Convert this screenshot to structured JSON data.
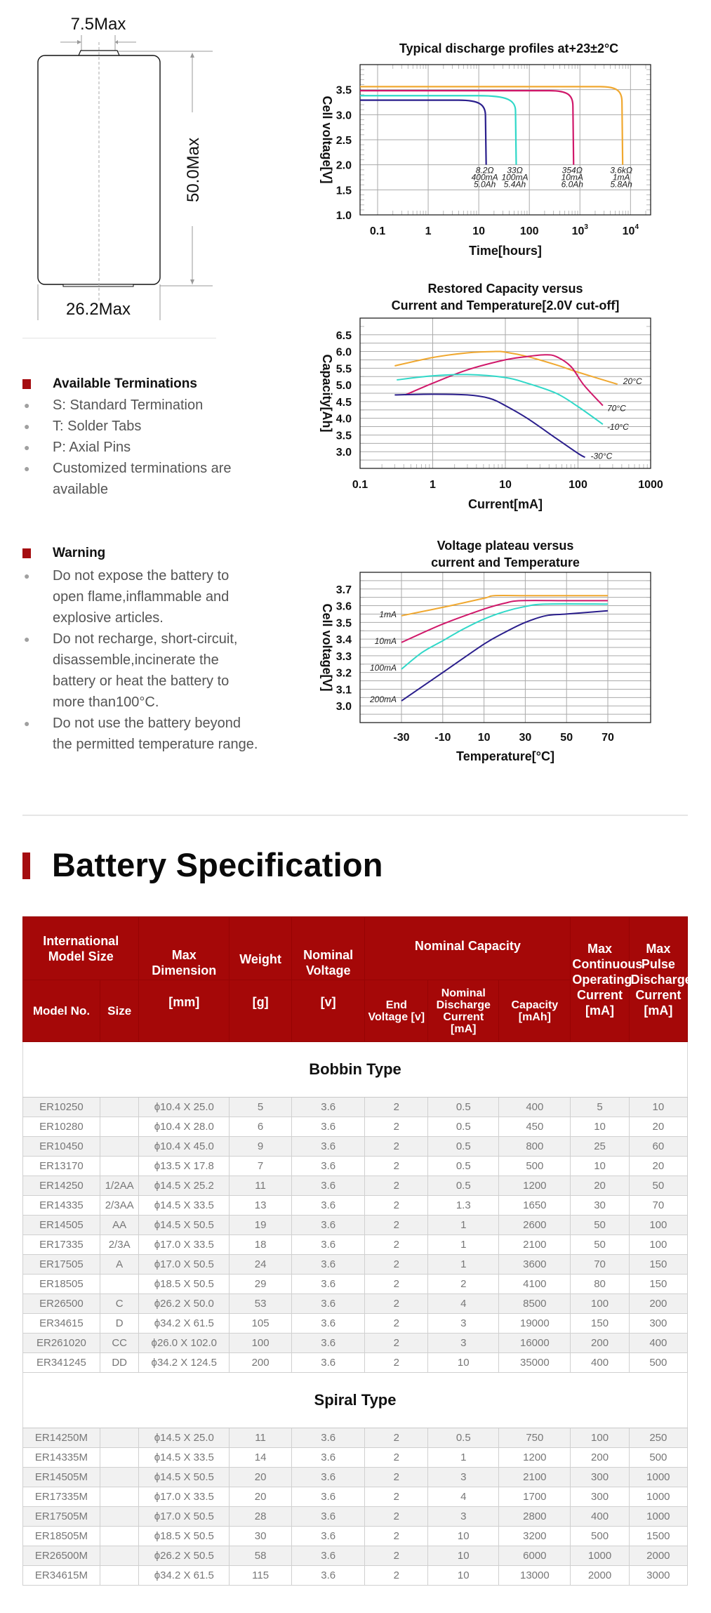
{
  "drawing": {
    "top_width_label": "7.5Max",
    "height_label": "50.0Max",
    "diameter_label": "26.2Max"
  },
  "terminations": {
    "title": "Available Terminations",
    "items": [
      "S: Standard Termination",
      "T: Solder Tabs",
      "P: Axial Pins",
      "Customized terminations are available"
    ]
  },
  "warning": {
    "title": "Warning",
    "items": [
      "Do not expose the battery to open flame,inflammable and explosive articles.",
      "Do not recharge, short-circuit, disassemble,incinerate the battery or heat the battery to more than100°C.",
      "Do not use the battery beyond the permitted temperature range."
    ]
  },
  "colors": {
    "accent_red": "#a50d10",
    "header_red": "#a50808",
    "series_orange": "#f0a830",
    "series_magenta": "#d0186a",
    "series_cyan": "#30d8c8",
    "series_navy": "#2a1e8c"
  },
  "chart_data": [
    {
      "type": "line",
      "title": "Typical discharge profiles at+23±2°C",
      "xlabel": "Time[hours]",
      "ylabel": "Cell voltage[V]",
      "x_scale": "log",
      "xlim": [
        0.045,
        25000
      ],
      "ylim": [
        1.0,
        4.0
      ],
      "xticks": [
        0.1,
        1,
        10,
        100,
        1000,
        10000
      ],
      "xtick_labels": [
        "0.1",
        "1",
        "10",
        "100",
        "10^3",
        "10^4"
      ],
      "yticks": [
        1.0,
        1.5,
        2.0,
        2.5,
        3.0,
        3.5
      ],
      "ytick_labels": [
        "1.0",
        "1.5",
        "2.0",
        "2.5",
        "3.0",
        "3.5"
      ],
      "grid": true,
      "series": [
        {
          "name": "3.6kΩ 1mA 5.8Ah",
          "color": "#f0a830",
          "plateau_v": 3.56,
          "knee_start_h": 2500,
          "end_h": 7000,
          "cutoff_v": 2.0,
          "annotation": [
            "3.6kΩ",
            "1mA",
            "5.8Ah"
          ]
        },
        {
          "name": "354Ω 10mA 6.0Ah",
          "color": "#d0186a",
          "plateau_v": 3.48,
          "knee_start_h": 250,
          "end_h": 750,
          "cutoff_v": 2.0,
          "annotation": [
            "354Ω",
            "10mA",
            "6.0Ah"
          ]
        },
        {
          "name": "33Ω 100mA 5.4Ah",
          "color": "#30d8c8",
          "plateau_v": 3.38,
          "knee_start_h": 10,
          "end_h": 55,
          "cutoff_v": 2.0,
          "annotation": [
            "33Ω",
            "100mA",
            "5.4Ah"
          ]
        },
        {
          "name": "8.2Ω 400mA 5.0Ah",
          "color": "#2a1e8c",
          "plateau_v": 3.29,
          "knee_start_h": 4,
          "end_h": 14,
          "cutoff_v": 2.0,
          "annotation": [
            "8.2Ω",
            "400mA",
            "5.0Ah"
          ]
        }
      ]
    },
    {
      "type": "line",
      "title": "Restored Capacity versus Current and Temperature[2.0V cut-off]",
      "title_lines": [
        "Restored Capacity versus",
        "Current and Temperature[2.0V cut-off]"
      ],
      "xlabel": "Current[mA]",
      "ylabel": "Capacity[Ah]",
      "x_scale": "log",
      "xlim": [
        0.1,
        1000
      ],
      "ylim": [
        2.5,
        7.0
      ],
      "xticks": [
        0.1,
        1,
        10,
        100,
        1000
      ],
      "xtick_labels": [
        "0.1",
        "1",
        "10",
        "100",
        "1000"
      ],
      "yticks": [
        3.0,
        3.5,
        4.0,
        4.5,
        5.0,
        5.5,
        6.0,
        6.5
      ],
      "ytick_labels": [
        "3.0",
        "3.5",
        "4.0",
        "4.5",
        "5.0",
        "5.5",
        "6.0",
        "6.5"
      ],
      "grid": true,
      "series": [
        {
          "name": "20°C",
          "color": "#f0a830",
          "x": [
            0.3,
            1,
            3,
            7,
            10,
            20,
            50,
            100,
            350
          ],
          "y": [
            5.57,
            5.82,
            5.96,
            6.0,
            5.98,
            5.85,
            5.6,
            5.38,
            5.02
          ]
        },
        {
          "name": "70°C",
          "color": "#d0186a",
          "x": [
            0.42,
            1,
            3,
            10,
            20,
            35,
            50,
            80,
            120,
            220
          ],
          "y": [
            4.7,
            5.05,
            5.45,
            5.75,
            5.85,
            5.9,
            5.85,
            5.55,
            5.0,
            4.38
          ]
        },
        {
          "name": "-10°C",
          "color": "#30d8c8",
          "x": [
            0.32,
            1,
            3,
            10,
            20,
            50,
            100,
            220
          ],
          "y": [
            5.15,
            5.27,
            5.31,
            5.22,
            5.05,
            4.75,
            4.35,
            3.82
          ]
        },
        {
          "name": "-30°C",
          "color": "#2a1e8c",
          "x": [
            0.3,
            1,
            3,
            6,
            10,
            20,
            50,
            100,
            125
          ],
          "y": [
            4.7,
            4.72,
            4.7,
            4.6,
            4.38,
            4.0,
            3.4,
            2.95,
            2.83
          ]
        }
      ]
    },
    {
      "type": "line",
      "title": "Voltage plateau versus current and Temperature",
      "title_lines": [
        "Voltage plateau versus",
        "current and Temperature"
      ],
      "xlabel": "Temperature[°C]",
      "ylabel": "Cell voltage[V]",
      "xlim": [
        -50,
        90
      ],
      "ylim": [
        2.9,
        3.8
      ],
      "xticks": [
        -30,
        -10,
        10,
        30,
        50,
        70
      ],
      "xtick_labels": [
        "-30",
        "-10",
        "10",
        "30",
        "50",
        "70"
      ],
      "yticks": [
        3.0,
        3.1,
        3.2,
        3.3,
        3.4,
        3.5,
        3.6,
        3.7
      ],
      "ytick_labels": [
        "3.0",
        "3.1",
        "3.2",
        "3.3",
        "3.4",
        "3.5",
        "3.6",
        "3.7"
      ],
      "grid": true,
      "series": [
        {
          "name": "1mA",
          "color": "#f0a830",
          "x": [
            -30,
            -10,
            10,
            15,
            30,
            50,
            70
          ],
          "y": [
            3.54,
            3.59,
            3.645,
            3.66,
            3.66,
            3.66,
            3.66
          ]
        },
        {
          "name": "10mA",
          "color": "#d0186a",
          "x": [
            -30,
            -10,
            10,
            20,
            28,
            50,
            70
          ],
          "y": [
            3.38,
            3.49,
            3.58,
            3.615,
            3.63,
            3.63,
            3.63
          ]
        },
        {
          "name": "100mA",
          "color": "#30d8c8",
          "x": [
            -30,
            -20,
            -10,
            0,
            10,
            20,
            30,
            40,
            70
          ],
          "y": [
            3.22,
            3.32,
            3.39,
            3.46,
            3.52,
            3.565,
            3.595,
            3.61,
            3.61
          ]
        },
        {
          "name": "200mA",
          "color": "#2a1e8c",
          "x": [
            -30,
            -10,
            10,
            20,
            30,
            40,
            50,
            70
          ],
          "y": [
            3.03,
            3.2,
            3.37,
            3.44,
            3.5,
            3.54,
            3.55,
            3.57
          ]
        }
      ]
    }
  ],
  "spec": {
    "title": "Battery Specification",
    "header": {
      "intl_model_size": "International Model Size",
      "max_dimension": "Max Dimension",
      "weight": "Weight",
      "nominal_voltage": "Nominal Voltage",
      "nominal_capacity": "Nominal Capacity",
      "max_continuous": "Max Continuous Operating Current [mA]",
      "max_pulse": "Max Pulse Discharge Current [mA]",
      "model_no": "Model No.",
      "size": "Size",
      "unit_mm": "[mm]",
      "unit_g": "[g]",
      "unit_v": "[v]",
      "end_voltage": "End Voltage [v]",
      "nominal_discharge_current": "Nominal Discharge Current [mA]",
      "capacity": "Capacity [mAh]"
    },
    "groups": [
      {
        "name": "Bobbin Type",
        "rows": [
          [
            "ER10250",
            "",
            "ϕ10.4 X 25.0",
            "5",
            "3.6",
            "2",
            "0.5",
            "400",
            "5",
            "10"
          ],
          [
            "ER10280",
            "",
            "ϕ10.4 X 28.0",
            "6",
            "3.6",
            "2",
            "0.5",
            "450",
            "10",
            "20"
          ],
          [
            "ER10450",
            "",
            "ϕ10.4 X 45.0",
            "9",
            "3.6",
            "2",
            "0.5",
            "800",
            "25",
            "60"
          ],
          [
            "ER13170",
            "",
            "ϕ13.5 X 17.8",
            "7",
            "3.6",
            "2",
            "0.5",
            "500",
            "10",
            "20"
          ],
          [
            "ER14250",
            "1/2AA",
            "ϕ14.5 X 25.2",
            "11",
            "3.6",
            "2",
            "0.5",
            "1200",
            "20",
            "50"
          ],
          [
            "ER14335",
            "2/3AA",
            "ϕ14.5 X 33.5",
            "13",
            "3.6",
            "2",
            "1.3",
            "1650",
            "30",
            "70"
          ],
          [
            "ER14505",
            "AA",
            "ϕ14.5 X 50.5",
            "19",
            "3.6",
            "2",
            "1",
            "2600",
            "50",
            "100"
          ],
          [
            "ER17335",
            "2/3A",
            "ϕ17.0 X 33.5",
            "18",
            "3.6",
            "2",
            "1",
            "2100",
            "50",
            "100"
          ],
          [
            "ER17505",
            "A",
            "ϕ17.0 X 50.5",
            "24",
            "3.6",
            "2",
            "1",
            "3600",
            "70",
            "150"
          ],
          [
            "ER18505",
            "",
            "ϕ18.5 X 50.5",
            "29",
            "3.6",
            "2",
            "2",
            "4100",
            "80",
            "150"
          ],
          [
            "ER26500",
            "C",
            "ϕ26.2 X 50.0",
            "53",
            "3.6",
            "2",
            "4",
            "8500",
            "100",
            "200"
          ],
          [
            "ER34615",
            "D",
            "ϕ34.2 X 61.5",
            "105",
            "3.6",
            "2",
            "3",
            "19000",
            "150",
            "300"
          ],
          [
            "ER261020",
            "CC",
            "ϕ26.0 X 102.0",
            "100",
            "3.6",
            "2",
            "3",
            "16000",
            "200",
            "400"
          ],
          [
            "ER341245",
            "DD",
            "ϕ34.2 X 124.5",
            "200",
            "3.6",
            "2",
            "10",
            "35000",
            "400",
            "500"
          ]
        ]
      },
      {
        "name": "Spiral Type",
        "rows": [
          [
            "ER14250M",
            "",
            "ϕ14.5 X 25.0",
            "11",
            "3.6",
            "2",
            "0.5",
            "750",
            "100",
            "250"
          ],
          [
            "ER14335M",
            "",
            "ϕ14.5 X 33.5",
            "14",
            "3.6",
            "2",
            "1",
            "1200",
            "200",
            "500"
          ],
          [
            "ER14505M",
            "",
            "ϕ14.5 X 50.5",
            "20",
            "3.6",
            "2",
            "3",
            "2100",
            "300",
            "1000"
          ],
          [
            "ER17335M",
            "",
            "ϕ17.0 X 33.5",
            "20",
            "3.6",
            "2",
            "4",
            "1700",
            "300",
            "1000"
          ],
          [
            "ER17505M",
            "",
            "ϕ17.0 X 50.5",
            "28",
            "3.6",
            "2",
            "3",
            "2800",
            "400",
            "1000"
          ],
          [
            "ER18505M",
            "",
            "ϕ18.5 X 50.5",
            "30",
            "3.6",
            "2",
            "10",
            "3200",
            "500",
            "1500"
          ],
          [
            "ER26500M",
            "",
            "ϕ26.2 X 50.5",
            "58",
            "3.6",
            "2",
            "10",
            "6000",
            "1000",
            "2000"
          ],
          [
            "ER34615M",
            "",
            "ϕ34.2 X 61.5",
            "115",
            "3.6",
            "2",
            "10",
            "13000",
            "2000",
            "3000"
          ]
        ]
      }
    ]
  }
}
